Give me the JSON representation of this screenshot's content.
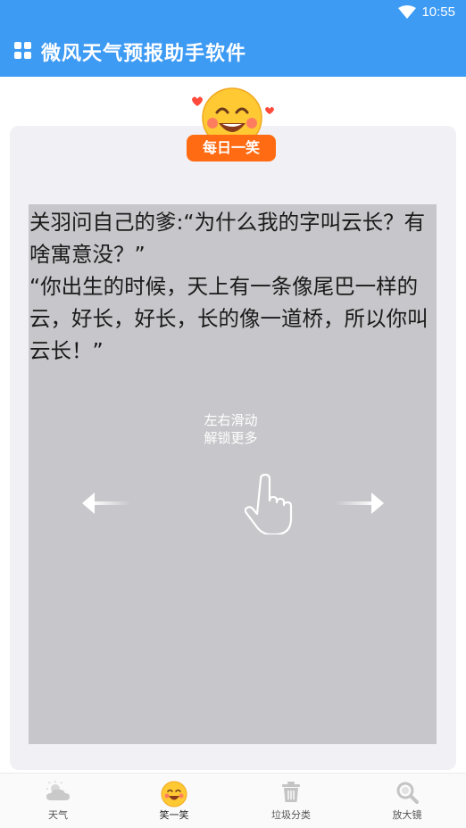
{
  "status": {
    "time": "10:55"
  },
  "header": {
    "title": "微风天气预报助手软件"
  },
  "badge": {
    "label": "每日一笑"
  },
  "joke": {
    "text": "关羽问自己的爹:“为什么我的字叫云长？有啥寓意没？”\n“你出生的时候，天上有一条像尾巴一样的云，好长，好长，长的像一道桥，所以你叫云长！”"
  },
  "hint": {
    "line1": "左右滑动",
    "line2": "解锁更多"
  },
  "tabs": [
    {
      "label": "天气",
      "icon": "weather-icon"
    },
    {
      "label": "笑一笑",
      "icon": "smile-icon"
    },
    {
      "label": "垃圾分类",
      "icon": "trash-icon"
    },
    {
      "label": "放大镜",
      "icon": "magnifier-icon"
    }
  ],
  "colors": {
    "primary": "#3e9bf4",
    "badge": "#ff6b13",
    "joke_bg": "#c7c7cb"
  }
}
